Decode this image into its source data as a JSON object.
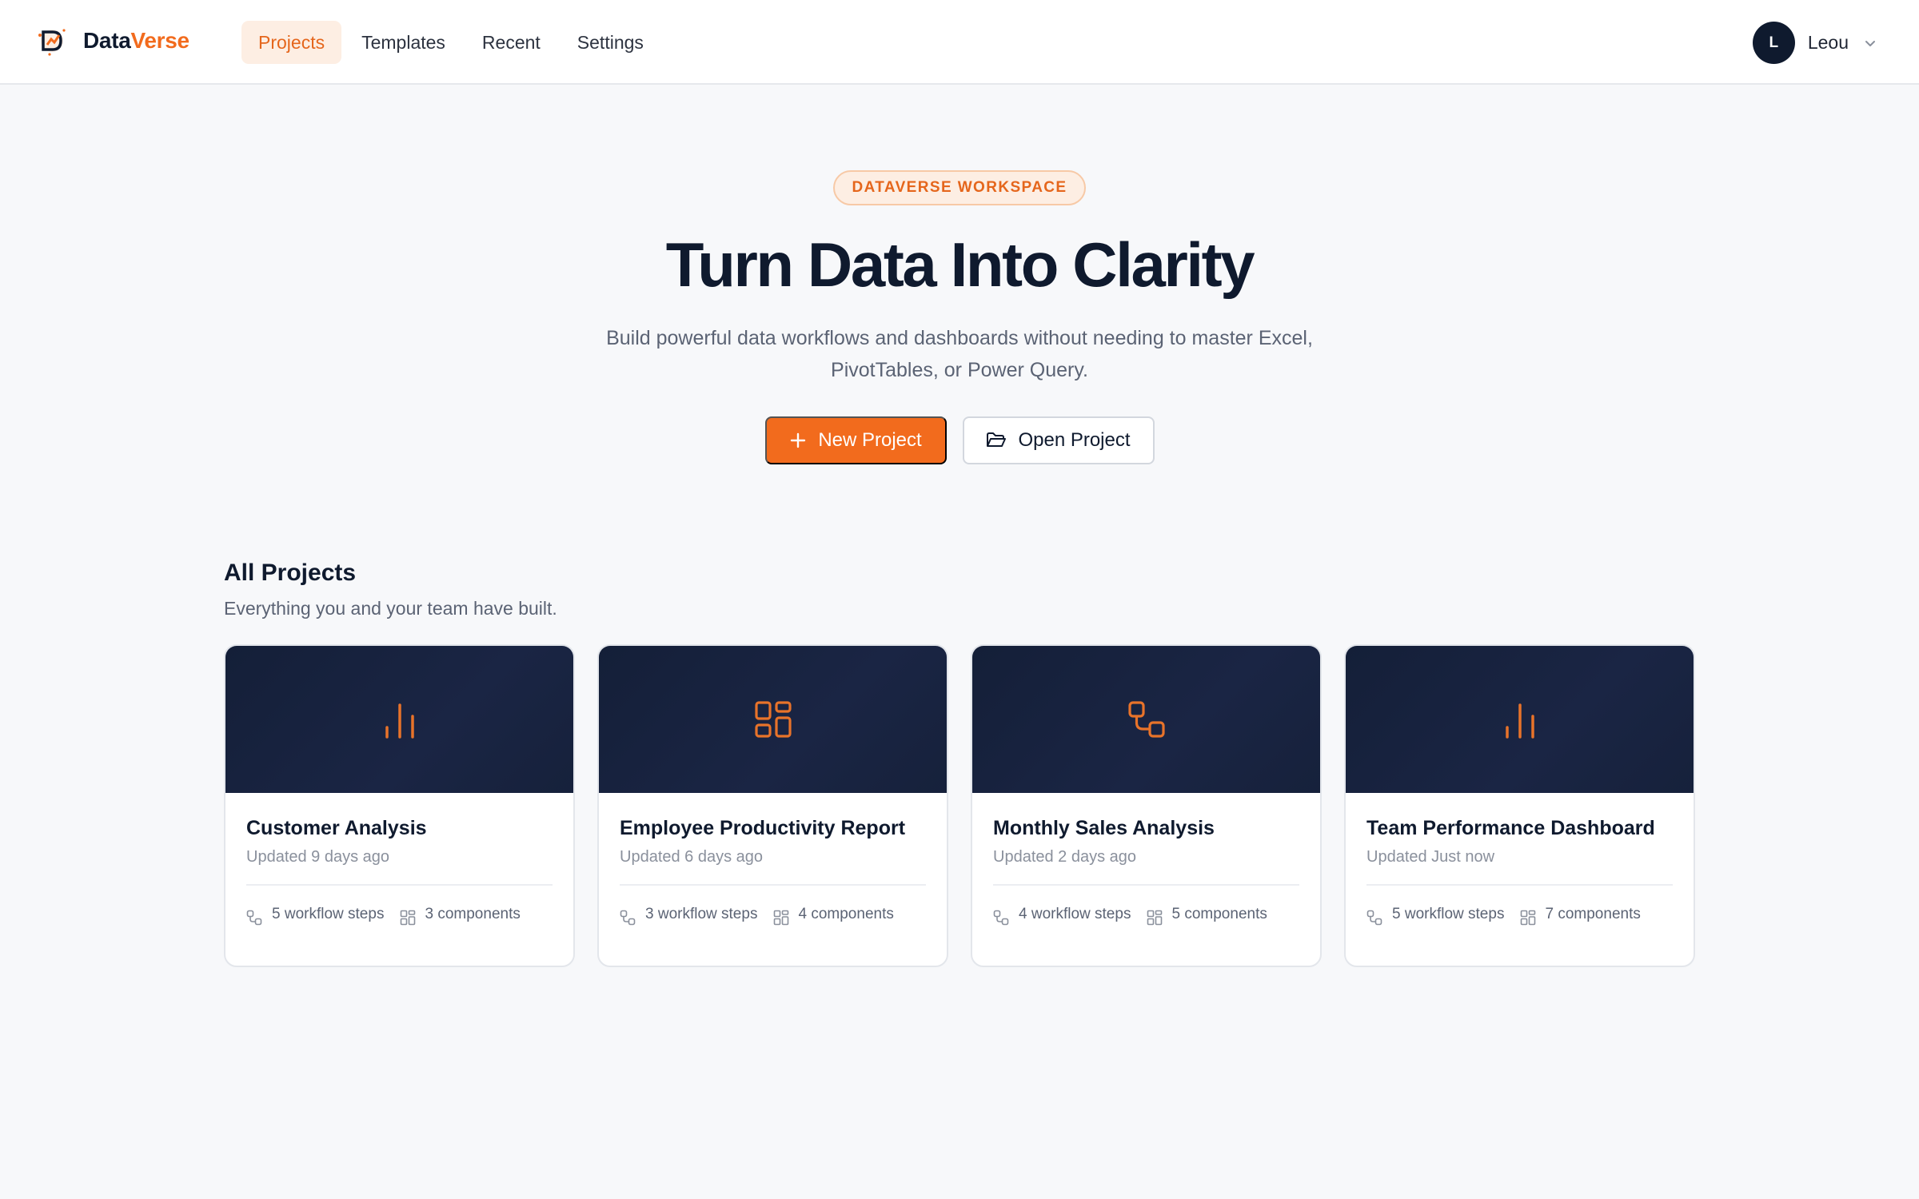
{
  "app": {
    "name_part1": "Data",
    "name_part2": "Verse"
  },
  "nav": {
    "items": [
      {
        "label": "Projects",
        "active": true
      },
      {
        "label": "Templates",
        "active": false
      },
      {
        "label": "Recent",
        "active": false
      },
      {
        "label": "Settings",
        "active": false
      }
    ]
  },
  "user": {
    "initial": "L",
    "name": "Leou"
  },
  "hero": {
    "badge": "DATAVERSE WORKSPACE",
    "title": "Turn Data Into Clarity",
    "subtitle": "Build powerful data workflows and dashboards without needing to master Excel, PivotTables, or Power Query.",
    "new_project_label": "New Project",
    "open_project_label": "Open Project"
  },
  "projects": {
    "title": "All Projects",
    "subtitle": "Everything you and your team have built.",
    "cards": [
      {
        "name": "Customer Analysis",
        "updated": "Updated 9 days ago",
        "workflow_steps": "5 workflow steps",
        "components": "3 components",
        "icon": "bar-chart-icon"
      },
      {
        "name": "Employee Productivity Report",
        "updated": "Updated 6 days ago",
        "workflow_steps": "3 workflow steps",
        "components": "4 components",
        "icon": "dashboard-grid-icon"
      },
      {
        "name": "Monthly Sales Analysis",
        "updated": "Updated 2 days ago",
        "workflow_steps": "4 workflow steps",
        "components": "5 components",
        "icon": "workflow-icon"
      },
      {
        "name": "Team Performance Dashboard",
        "updated": "Updated Just now",
        "workflow_steps": "5 workflow steps",
        "components": "7 components",
        "icon": "bar-chart-icon"
      }
    ]
  },
  "colors": {
    "accent": "#f26b1d",
    "navy": "#0f1a2e",
    "banner": "#16213b"
  }
}
